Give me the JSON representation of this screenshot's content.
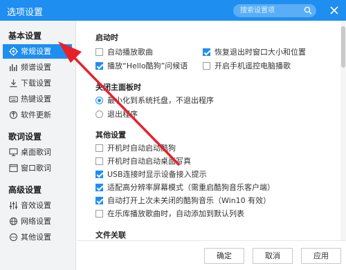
{
  "window": {
    "title": "选项设置",
    "search_placeholder": "搜索设置项",
    "close_icon": "close-icon"
  },
  "sidebar": {
    "sections": [
      {
        "title": "基本设置",
        "items": [
          {
            "label": "常规设置",
            "icon": "target-icon",
            "active": true
          },
          {
            "label": "频谱设置",
            "icon": "spectrum-icon"
          },
          {
            "label": "下载设置",
            "icon": "download-icon"
          },
          {
            "label": "热键设置",
            "icon": "keyboard-icon"
          },
          {
            "label": "软件更新",
            "icon": "update-icon"
          }
        ]
      },
      {
        "title": "歌词设置",
        "items": [
          {
            "label": "桌面歌词",
            "icon": "desktop-lyrics-icon"
          },
          {
            "label": "窗口歌词",
            "icon": "window-lyrics-icon"
          }
        ]
      },
      {
        "title": "高级设置",
        "items": [
          {
            "label": "音效设置",
            "icon": "equalizer-icon"
          },
          {
            "label": "网络设置",
            "icon": "network-icon"
          },
          {
            "label": "其他设置",
            "icon": "more-icon"
          }
        ]
      }
    ]
  },
  "content": {
    "startup": {
      "title": "启动时",
      "options": [
        {
          "label": "自动播放歌曲",
          "checked": false
        },
        {
          "label": "恢复退出时窗口大小和位置",
          "checked": true
        },
        {
          "label": "播放“Hello酷狗”问候语",
          "checked": true
        },
        {
          "label": "开启手机遥控电脑播歌",
          "checked": false
        }
      ]
    },
    "close_panel": {
      "title": "关闭主面板时",
      "options": [
        {
          "label": "最小化到系统托盘，不退出程序",
          "selected": true
        },
        {
          "label": "退出程序",
          "selected": false
        }
      ]
    },
    "other": {
      "title": "其他设置",
      "options": [
        {
          "label": "开机时自动启动酷狗",
          "checked": false
        },
        {
          "label": "开机时自动启动桌面写真",
          "checked": false
        },
        {
          "label": "USB连接时显示设备接入提示",
          "checked": true
        },
        {
          "label": "适配高分辨率屏幕模式（需重启酷狗音乐客户端）",
          "checked": true
        },
        {
          "label": "自动打开上次未关闭的酷狗音乐（Win10 有效）",
          "checked": true
        },
        {
          "label": "在乐库播放歌曲时，自动添加到默认列表",
          "checked": false
        }
      ]
    },
    "file_assoc": {
      "title": "文件关联"
    }
  },
  "footer": {
    "ok": "确定",
    "cancel": "取消",
    "apply": "应用"
  },
  "colors": {
    "accent": "#1e8ef0",
    "annotation_arrow": "#e8202a"
  }
}
